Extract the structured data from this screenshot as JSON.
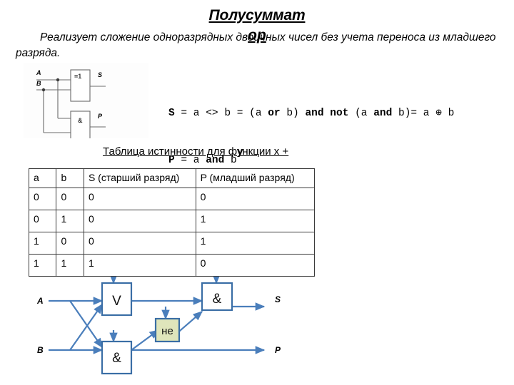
{
  "slide": {
    "title_line1": "Полусуммат",
    "title_line2": "ор",
    "title_full": "Полусумматор",
    "body_text": "Реализует сложение одноразрядных двоичных чисел без учета переноса из младшего разряда."
  },
  "formula": {
    "line1_parts": [
      {
        "t": "S",
        "b": true
      },
      {
        "t": " = a <> b = ",
        "b": false
      },
      {
        "t": "(a ",
        "b": false
      },
      {
        "t": "or",
        "b": true
      },
      {
        "t": " b) ",
        "b": false
      },
      {
        "t": "and not",
        "b": true
      },
      {
        "t": " (a ",
        "b": false
      },
      {
        "t": "and",
        "b": true
      },
      {
        "t": " b)= a ⊕ b",
        "b": false
      }
    ],
    "line2_parts": [
      {
        "t": "P",
        "b": true
      },
      {
        "t": " = a ",
        "b": false
      },
      {
        "t": "and",
        "b": true
      },
      {
        "t": " b",
        "b": false
      }
    ],
    "line1_plain": "S = a <> b = (a or b) and not (a and b)= a ⊕ b",
    "line2_plain": "P = a and b"
  },
  "top_circuit": {
    "input_a_label": "A",
    "input_b_label": "B",
    "xor_gate_label": "=1",
    "and_gate_label": "&",
    "output_s_label": "S",
    "output_p_label": "P"
  },
  "table": {
    "caption_line1": "Таблица истинности для функции x +",
    "caption_line2": "y",
    "caption_full": "Таблица истинности для функции x + y",
    "headers": [
      "a",
      "b",
      "S (старший разряд)",
      "P (младший разряд)"
    ],
    "rows": [
      [
        "0",
        "0",
        "0",
        "0"
      ],
      [
        "0",
        "1",
        "0",
        "1"
      ],
      [
        "1",
        "0",
        "0",
        "1"
      ],
      [
        "1",
        "1",
        "1",
        "0"
      ]
    ]
  },
  "bottom_circuit": {
    "input_a_label": "A",
    "input_b_label": "B",
    "or_gate_label": "V",
    "and_gate1_label": "&",
    "not_gate_label": "не",
    "and_gate2_label": "&",
    "output_s_label": "S",
    "output_p_label": "P"
  },
  "colors": {
    "wire_blue": "#4a7ebb",
    "gate_border": "#3a6ea5",
    "not_box_fill": "#dfe5bb",
    "gate_fill": "#ffffff",
    "table_border": "#3a3a3a",
    "text": "#000000"
  }
}
